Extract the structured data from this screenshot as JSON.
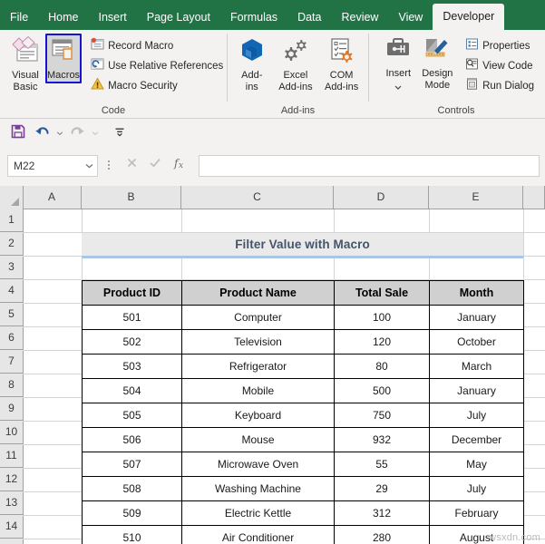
{
  "ribbon": {
    "tabs": [
      {
        "label": "File",
        "active": false
      },
      {
        "label": "Home",
        "active": false
      },
      {
        "label": "Insert",
        "active": false
      },
      {
        "label": "Page Layout",
        "active": false
      },
      {
        "label": "Formulas",
        "active": false
      },
      {
        "label": "Data",
        "active": false
      },
      {
        "label": "Review",
        "active": false
      },
      {
        "label": "View",
        "active": false
      },
      {
        "label": "Developer",
        "active": true
      }
    ],
    "groups": {
      "code": {
        "label": "Code",
        "visual_basic": "Visual\nBasic",
        "visual_basic_l1": "Visual",
        "visual_basic_l2": "Basic",
        "macros": "Macros",
        "record_macro": "Record Macro",
        "use_relative_references": "Use Relative References",
        "macro_security": "Macro Security",
        "highlight_color": "#1414d2"
      },
      "addins": {
        "label": "Add-ins",
        "addins_l1": "Add-",
        "addins_l2": "ins",
        "excel_l1": "Excel",
        "excel_l2": "Add-ins",
        "com_l1": "COM",
        "com_l2": "Add-ins"
      },
      "controls": {
        "label": "Controls",
        "insert": "Insert",
        "design_l1": "Design",
        "design_l2": "Mode",
        "properties": "Properties",
        "view_code": "View Code",
        "run_dialog": "Run Dialog"
      }
    }
  },
  "quick_access": {
    "save": "save-icon",
    "undo": "undo-icon",
    "redo": "redo-icon",
    "customize": "customize-qat-icon"
  },
  "formula_bar": {
    "name_box_value": "M22",
    "cancel": "cancel-icon",
    "enter": "enter-icon",
    "insert_function": "fx",
    "formula_value": ""
  },
  "grid": {
    "columns": [
      "A",
      "B",
      "C",
      "D",
      "E"
    ],
    "rows": [
      "1",
      "2",
      "3",
      "4",
      "5",
      "6",
      "7",
      "8",
      "9",
      "10",
      "11",
      "12",
      "13",
      "14"
    ]
  },
  "sheet": {
    "title": "Filter Value with Macro",
    "headers": [
      "Product ID",
      "Product Name",
      "Total Sale",
      "Month"
    ],
    "rows": [
      [
        "501",
        "Computer",
        "100",
        "January"
      ],
      [
        "502",
        "Television",
        "120",
        "October"
      ],
      [
        "503",
        "Refrigerator",
        "80",
        "March"
      ],
      [
        "504",
        "Mobile",
        "500",
        "January"
      ],
      [
        "505",
        "Keyboard",
        "750",
        "July"
      ],
      [
        "506",
        "Mouse",
        "932",
        "December"
      ],
      [
        "507",
        "Microwave Oven",
        "55",
        "May"
      ],
      [
        "508",
        "Washing Machine",
        "29",
        "July"
      ],
      [
        "509",
        "Electric Kettle",
        "312",
        "February"
      ],
      [
        "510",
        "Air Conditioner",
        "280",
        "August"
      ]
    ]
  },
  "watermark": "wsxdn.com",
  "colors": {
    "ribbon_green": "#217346",
    "title_text": "#44546a",
    "title_band": "#eaeaea",
    "title_underline": "#a9c6e4",
    "table_header_fill": "#d0d0d0"
  }
}
